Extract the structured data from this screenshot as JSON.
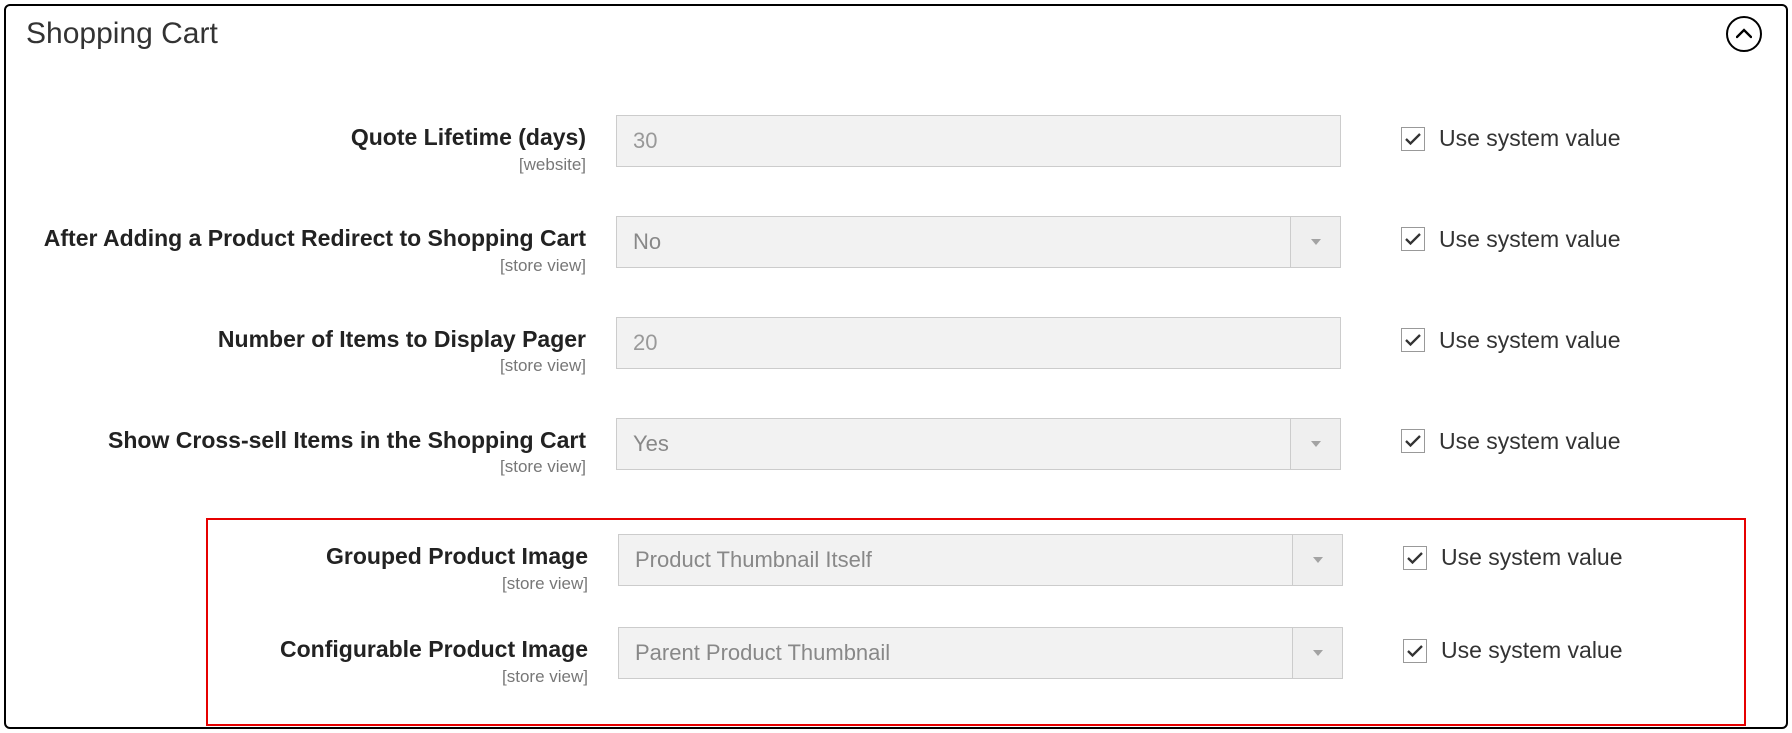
{
  "section": {
    "title": "Shopping Cart"
  },
  "scopes": {
    "website": "[website]",
    "store_view": "[store view]"
  },
  "system_value_label": "Use system value",
  "fields": {
    "quote_lifetime": {
      "label": "Quote Lifetime (days)",
      "value": "30"
    },
    "redirect_to_cart": {
      "label": "After Adding a Product Redirect to Shopping Cart",
      "value": "No"
    },
    "items_pager": {
      "label": "Number of Items to Display Pager",
      "value": "20"
    },
    "cross_sell": {
      "label": "Show Cross-sell Items in the Shopping Cart",
      "value": "Yes"
    },
    "grouped_image": {
      "label": "Grouped Product Image",
      "value": "Product Thumbnail Itself"
    },
    "configurable_image": {
      "label": "Configurable Product Image",
      "value": "Parent Product Thumbnail"
    }
  }
}
